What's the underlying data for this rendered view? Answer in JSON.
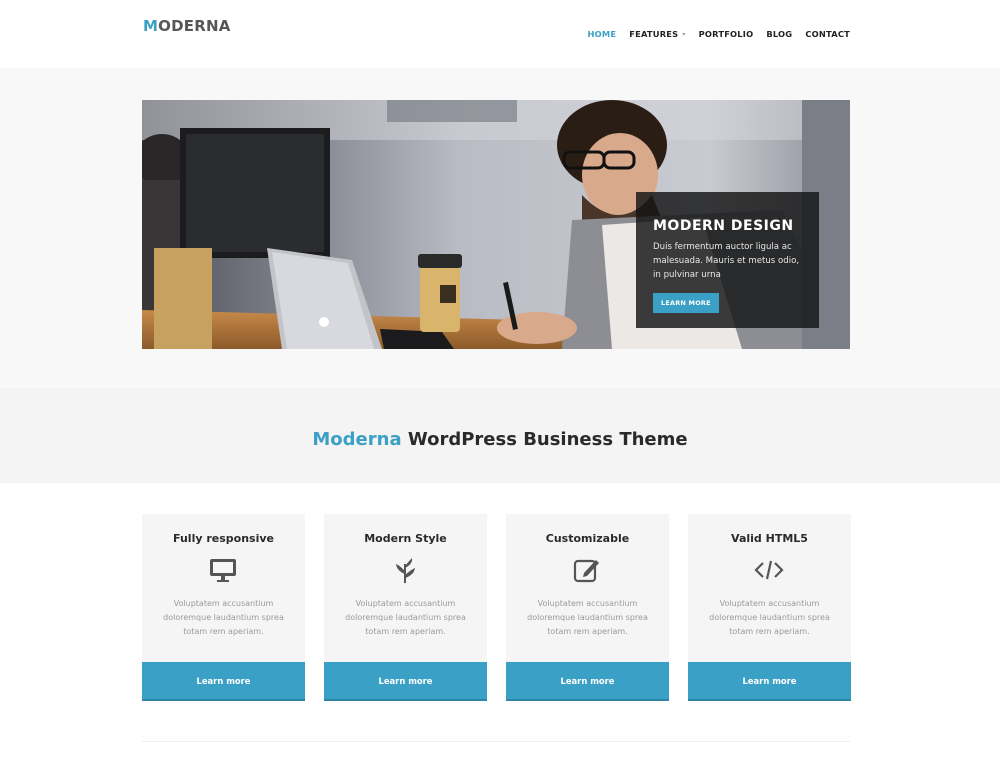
{
  "header": {
    "logo_accent": "M",
    "logo_rest": "ODERNA",
    "nav": [
      {
        "label": "HOME",
        "active": true
      },
      {
        "label": "FEATURES",
        "has_caret": true
      },
      {
        "label": "PORTFOLIO"
      },
      {
        "label": "BLOG"
      },
      {
        "label": "CONTACT"
      }
    ]
  },
  "hero": {
    "title": "MODERN DESIGN",
    "text": "Duis fermentum auctor ligula ac malesuada. Mauris et metus odio, in pulvinar urna",
    "button": "LEARN MORE"
  },
  "headline": {
    "accent": "Moderna",
    "rest": " WordPress Business Theme"
  },
  "features": [
    {
      "title": "Fully responsive",
      "icon": "desktop-icon",
      "text": "Voluptatem accusantium doloremque laudantium sprea totam rem aperiam.",
      "button": "Learn more"
    },
    {
      "title": "Modern Style",
      "icon": "leaf-icon",
      "text": "Voluptatem accusantium doloremque laudantium sprea totam rem aperiam.",
      "button": "Learn more"
    },
    {
      "title": "Customizable",
      "icon": "edit-icon",
      "text": "Voluptatem accusantium doloremque laudantium sprea totam rem aperiam.",
      "button": "Learn more"
    },
    {
      "title": "Valid HTML5",
      "icon": "code-icon",
      "text": "Voluptatem accusantium doloremque laudantium sprea totam rem aperiam.",
      "button": "Learn more"
    }
  ],
  "colors": {
    "accent": "#3aa0c5",
    "text_dark": "#2a2a2a",
    "muted": "#9a9a9a",
    "band": "#f4f4f4"
  }
}
